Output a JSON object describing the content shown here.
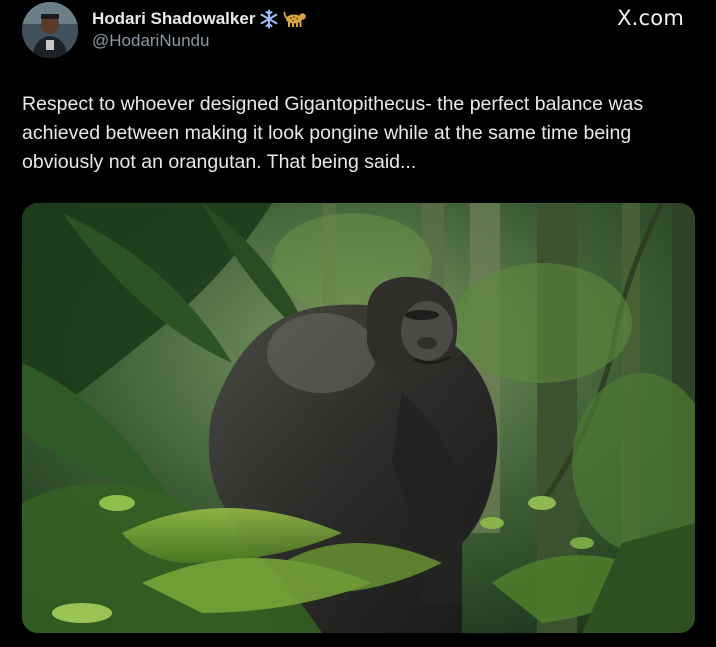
{
  "brand": {
    "label": "X.com"
  },
  "author": {
    "display_name": "Hodari Shadowalker",
    "handle": "@HodariNundu",
    "badges": [
      "snowflake-icon",
      "leopard-icon"
    ]
  },
  "tweet": {
    "text": "Respect to whoever designed Gigantopithecus- the perfect balance was achieved between making it look pongine while at the same time being obviously not an orangutan. That being said..."
  },
  "media": {
    "kind": "photo",
    "subject": "gigantopithecus-in-forest"
  },
  "colors": {
    "background": "#000000",
    "text": "#e7e9ea",
    "muted": "#8b98a5",
    "badge_blue": "#9fc3ff",
    "badge_gold": "#d9a441"
  }
}
